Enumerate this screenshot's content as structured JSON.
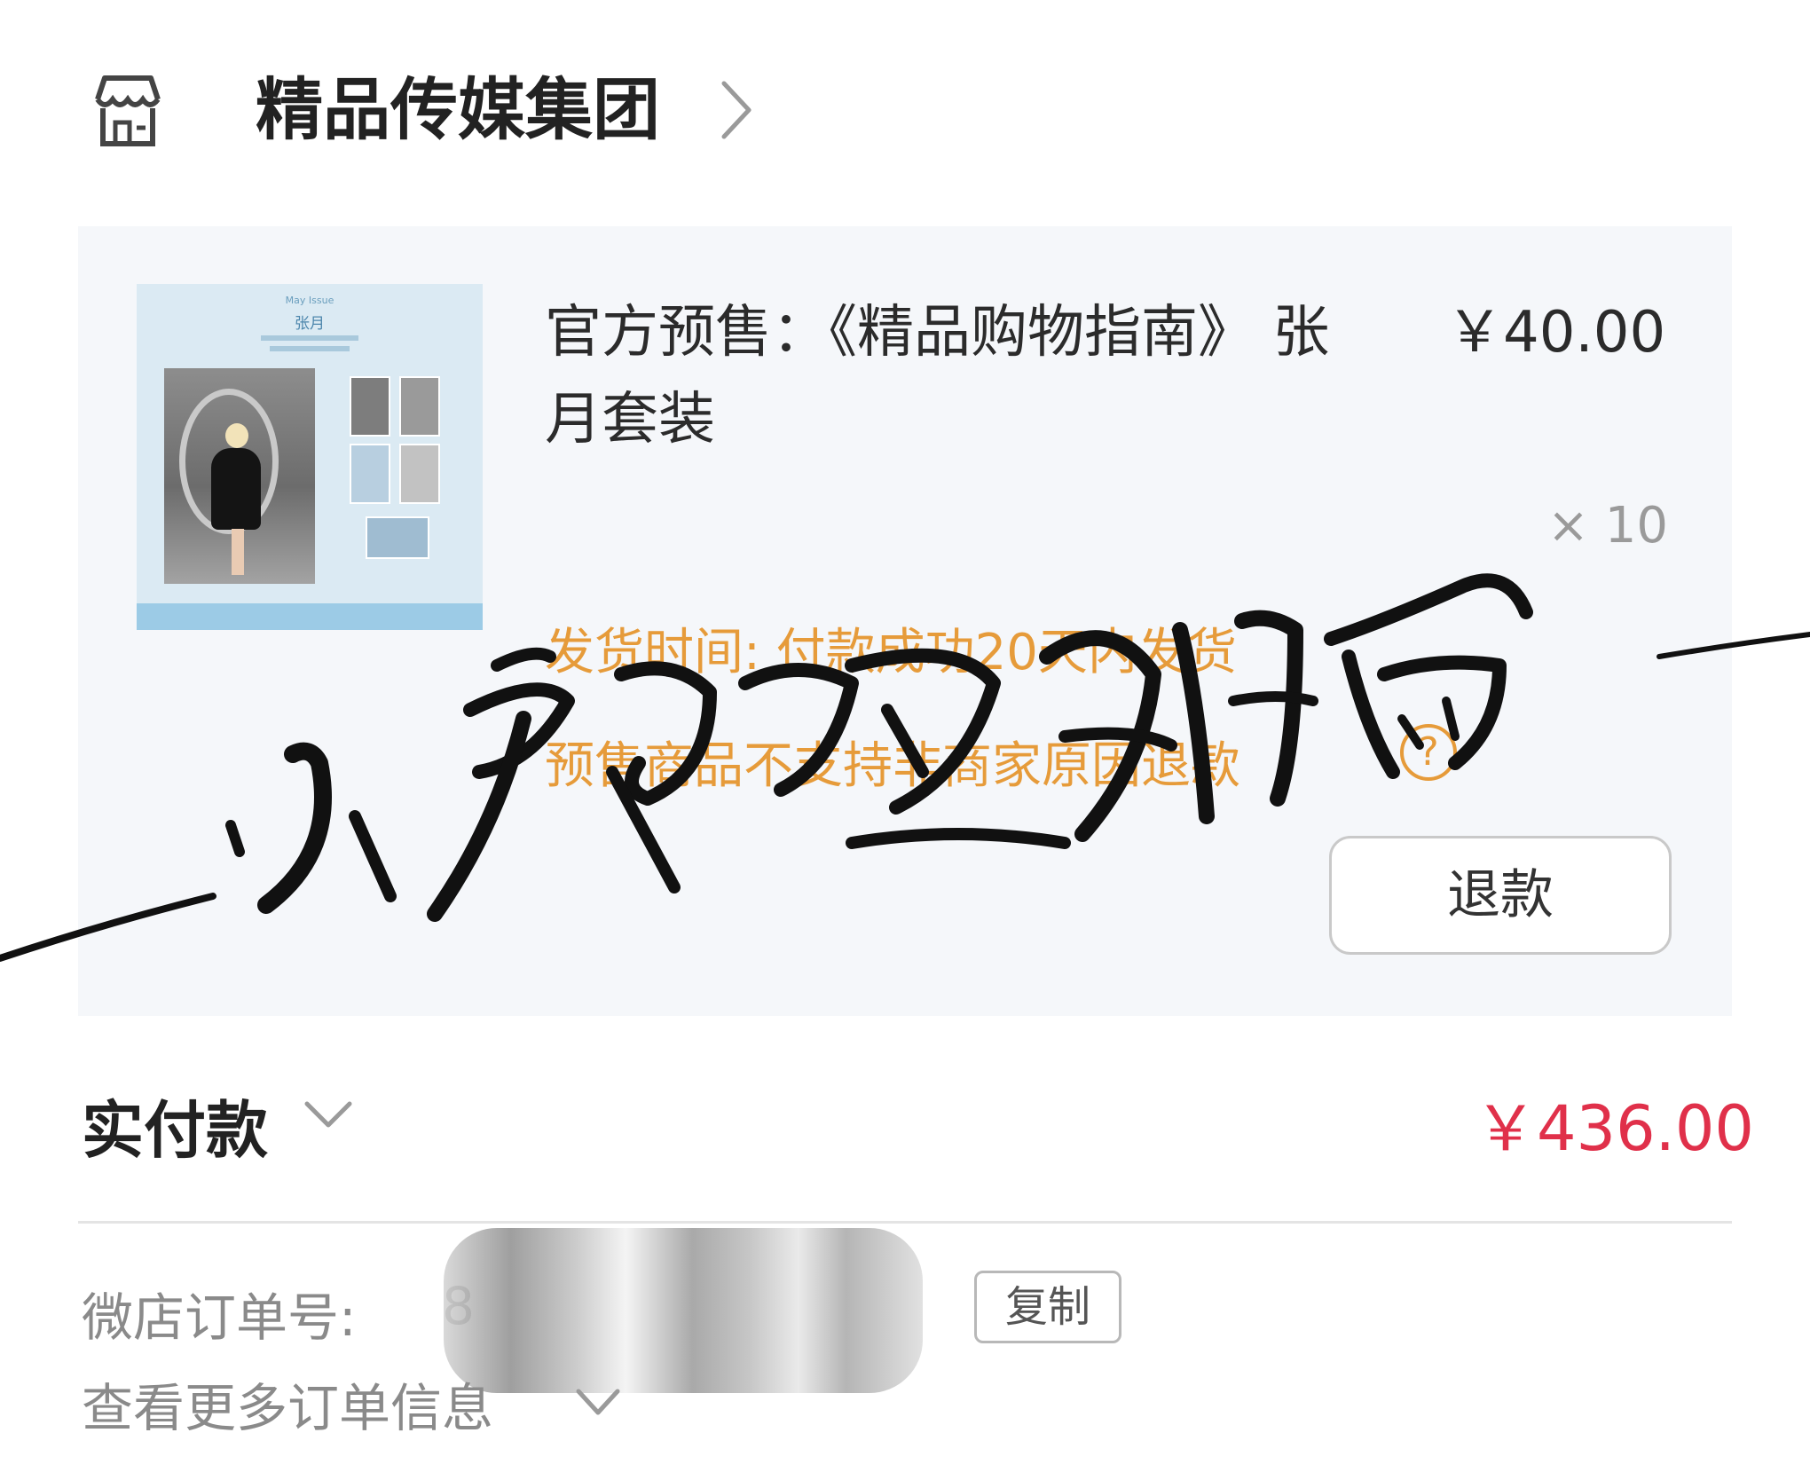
{
  "header": {
    "shop_name": "精品传媒集团",
    "shop_icon": "store-icon",
    "chevron_icon": "chevron-right-icon"
  },
  "product": {
    "title": "官方预售：《精品购物指南》 张月套装",
    "price": "￥40.00",
    "quantity": "× 10",
    "ship_time": "发货时间: 付款成功20天内发货",
    "presale_note": "预售商品不支持非商家原因退款",
    "help_icon": "help-circle-icon",
    "refund_button": "退款",
    "thumbnail": {
      "issue": "May Issue",
      "name": "张月"
    }
  },
  "payment": {
    "label": "实付款",
    "amount": "￥436.00",
    "chevron_icon": "chevron-down-icon",
    "accent_color": "#e0304a"
  },
  "order": {
    "number_label": "微店订单号:",
    "number_visible": "8",
    "copy_button": "复制",
    "more_info": "查看更多订单信息",
    "chevron_icon": "chevron-down-icon"
  },
  "overlay": {
    "signature": "小贺的鱼丸粗面"
  },
  "colors": {
    "warning": "#e69b3a",
    "card_background": "#f5f7fa"
  }
}
